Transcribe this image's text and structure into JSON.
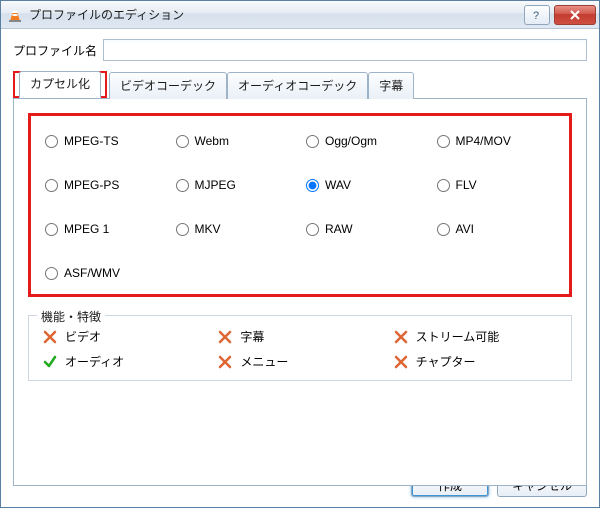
{
  "window": {
    "title": "プロファイルのエディション"
  },
  "profile": {
    "label": "プロファイル名",
    "value": ""
  },
  "tabs": {
    "encapsulation": "カプセル化",
    "video_codec": "ビデオコーデック",
    "audio_codec": "オーディオコーデック",
    "subtitles": "字幕"
  },
  "formats": {
    "selected": "WAV",
    "items": [
      "MPEG-TS",
      "Webm",
      "Ogg/Ogm",
      "MP4/MOV",
      "MPEG-PS",
      "MJPEG",
      "WAV",
      "FLV",
      "MPEG 1",
      "MKV",
      "RAW",
      "AVI",
      "ASF/WMV"
    ]
  },
  "features": {
    "legend": "機能・特徴",
    "items": [
      {
        "label": "ビデオ",
        "ok": false
      },
      {
        "label": "字幕",
        "ok": false
      },
      {
        "label": "ストリーム可能",
        "ok": false
      },
      {
        "label": "オーディオ",
        "ok": true
      },
      {
        "label": "メニュー",
        "ok": false
      },
      {
        "label": "チャプター",
        "ok": false
      }
    ]
  },
  "buttons": {
    "create": "作成",
    "cancel": "キャンセル"
  }
}
